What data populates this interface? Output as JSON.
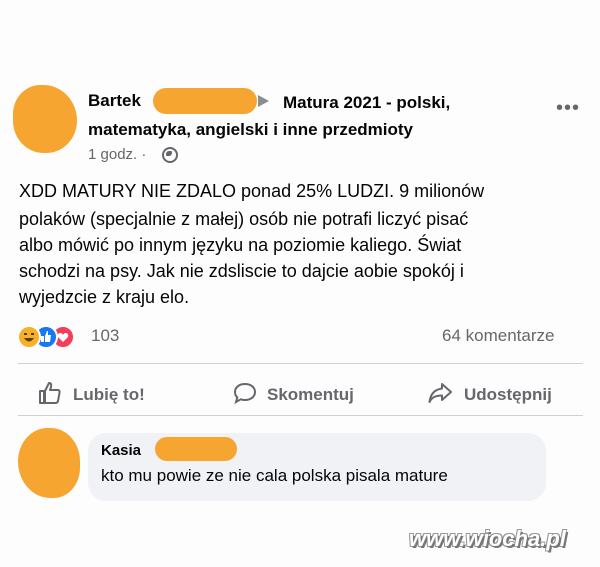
{
  "post": {
    "author": "Bartek",
    "group_line1": "Matura 2021 - polski,",
    "group_line2": "matematyka, angielski i inne przedmioty",
    "time": "1 godz. ·",
    "more_icon": "more-dots-icon",
    "text_lines": [
      "XDD MATURY NIE ZDALO ponad 25% LUDZI. 9 milionów",
      "polaków (specjalnie z małej) osób nie potrafi liczyć pisać",
      "albo mówić po innym języku na poziomie kaliego. Świat",
      "schodzi na psy. Jak nie zdsliscie to dajcie aobie spokój i",
      "wyjedzcie z kraju elo."
    ],
    "reactions_count": "103",
    "comments_count": "64 komentarze"
  },
  "actions": {
    "like": "Lubię to!",
    "comment": "Skomentuj",
    "share": "Udostępnij"
  },
  "comment": {
    "author": "Kasia",
    "text": "kto mu powie ze nie cala polska pisala mature"
  },
  "watermark": "www.wiocha.pl",
  "colors": {
    "redaction": "#f7a531",
    "haha": "#f7b125",
    "like": "#1877f2",
    "love": "#f33e58"
  }
}
